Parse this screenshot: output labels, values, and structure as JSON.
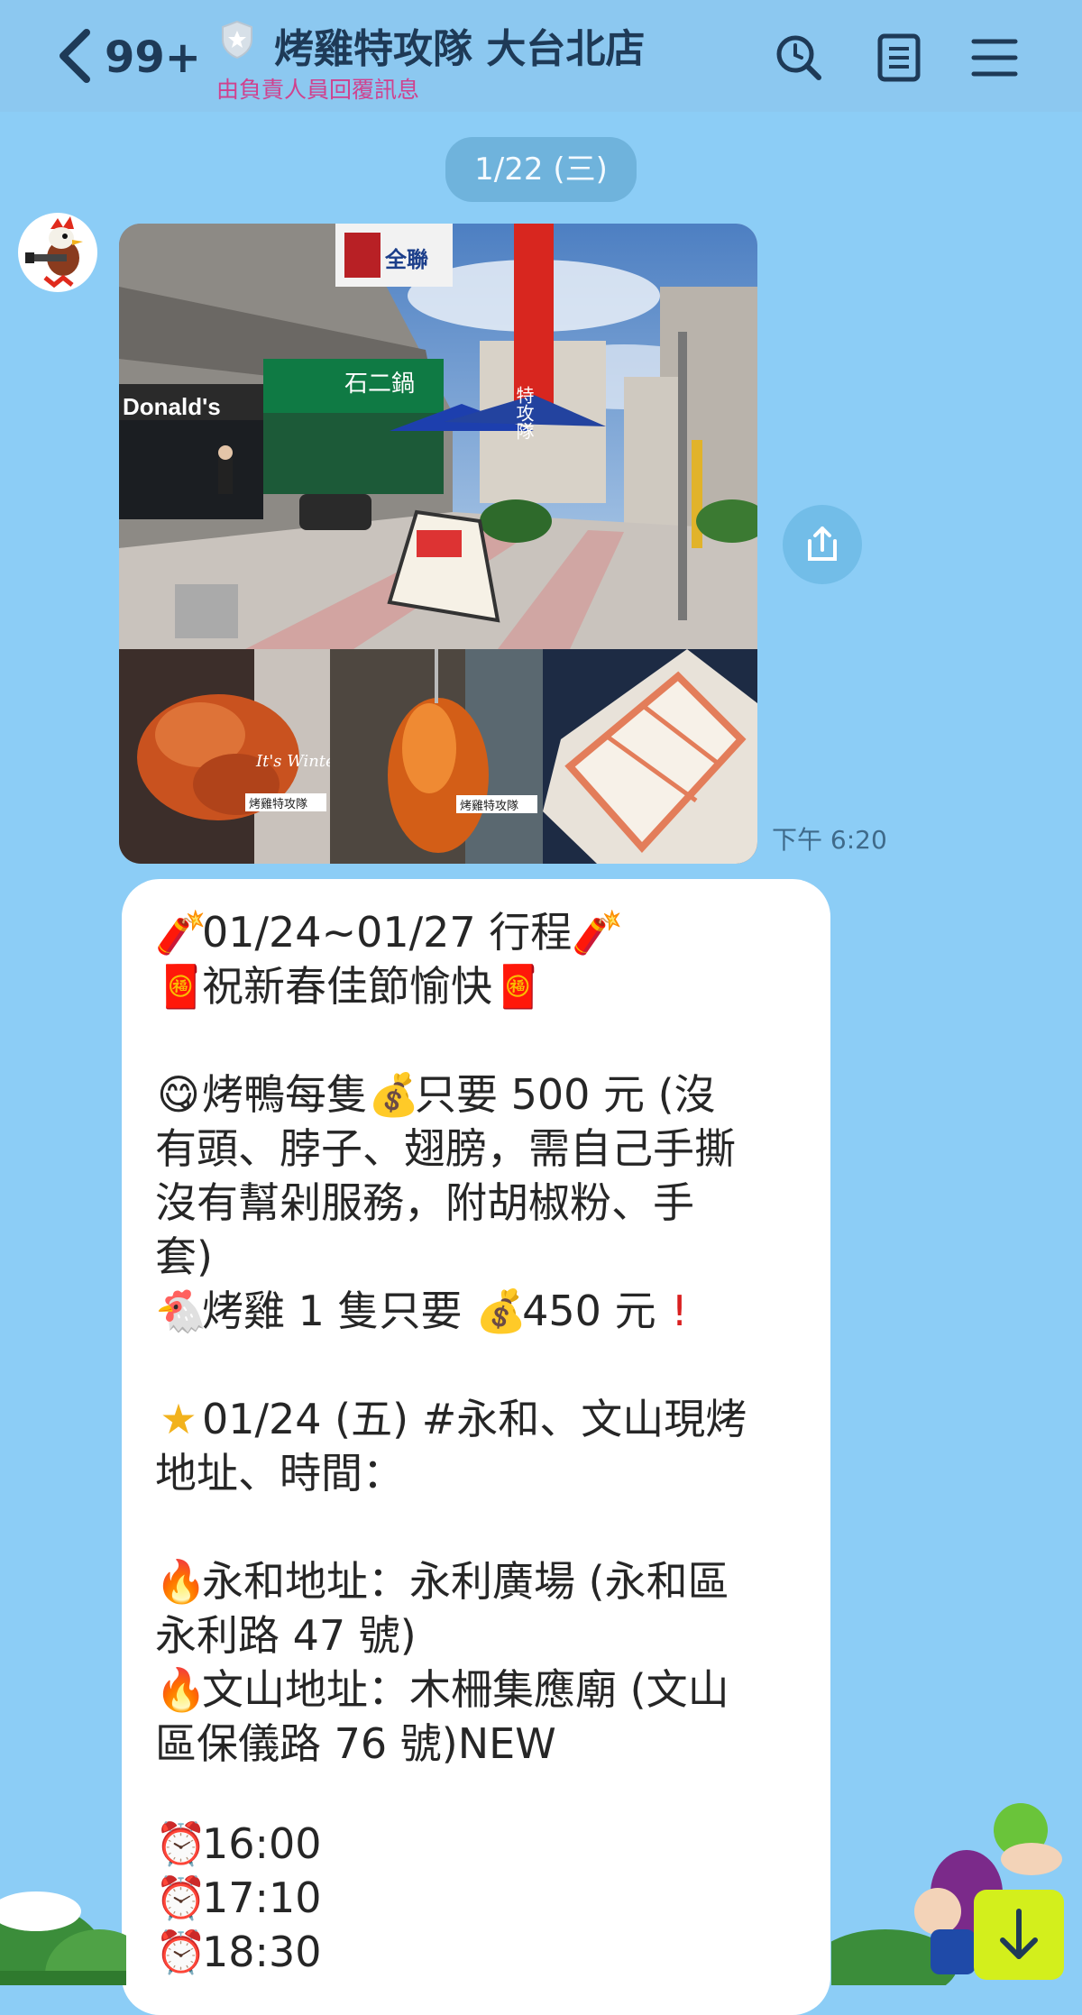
{
  "header": {
    "unread_count": "99+",
    "title": "烤雞特攻隊 大台北店",
    "subtitle": "由負責人員回覆訊息"
  },
  "chat": {
    "date": "1/22 (三)",
    "photo_time": "下午 6:20",
    "photo": {
      "main_signs": [
        "Donald's",
        "石二鍋",
        "全聯",
        "特攻隊"
      ],
      "sub_labels": [
        "烤雞特攻隊",
        "烤雞特攻隊"
      ],
      "winter_caption": "It's Winter."
    },
    "message_lines": [
      "01/24~01/27 行程",
      "祝新春佳節愉快",
      "",
      "烤鴨每隻",
      "只要 500 元 (沒",
      "有頭、脖子、翅膀，需自己手撕",
      "沒有幫剁服務，附胡椒粉、手",
      "套)",
      "烤雞 1 隻只要",
      "450 元",
      "01/24 (五) #永和、文山現烤",
      "地址、時間：",
      "永和地址：永利廣場 (永和區",
      "永利路 47 號)",
      "文山地址：木柵集應廟 (文山",
      "區保儀路 76 號)NEW",
      "16:00",
      "17:10",
      "18:30"
    ],
    "new_badge": "NEW"
  },
  "icons": {
    "back": "chevron-left-icon",
    "search": "search-icon",
    "notes": "notes-icon",
    "menu": "menu-icon",
    "share": "share-icon",
    "scroll": "arrow-down-icon"
  },
  "colors": {
    "background": "#8ccdf6",
    "header": "#8cc8f0",
    "subtitle": "#d0418e",
    "title": "#1e3a57",
    "scroll_button": "#d3ef1c"
  }
}
